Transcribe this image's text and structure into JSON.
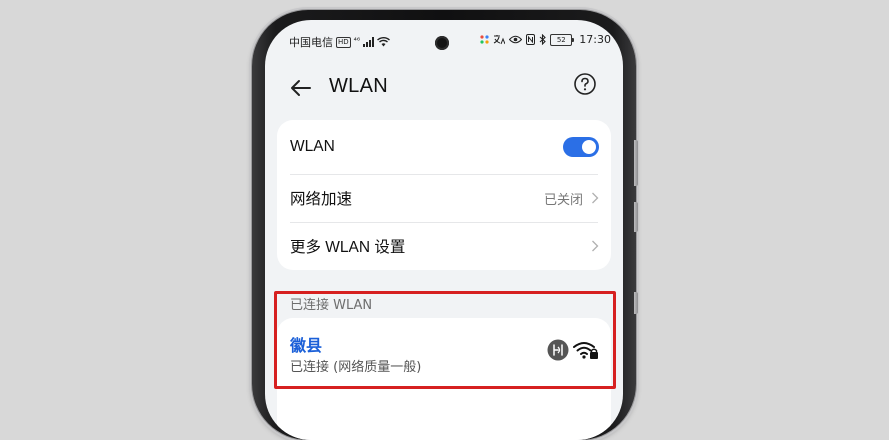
{
  "status_bar": {
    "carrier": "中国电信",
    "hd": "HD",
    "network": "⁴⁶",
    "battery": "52",
    "time": "17:30"
  },
  "header": {
    "title": "WLAN"
  },
  "settings": {
    "wlan_label": "WLAN",
    "wlan_enabled": true,
    "accel_label": "网络加速",
    "accel_value": "已关闭",
    "more_label": "更多 WLAN 设置"
  },
  "connected": {
    "section_title": "已连接 WLAN",
    "network_name": "徽县",
    "network_status": "已连接 (网络质量一般)"
  },
  "colors": {
    "accent": "#2b6fe6",
    "link": "#1a5fd8",
    "highlight": "#d62020"
  }
}
